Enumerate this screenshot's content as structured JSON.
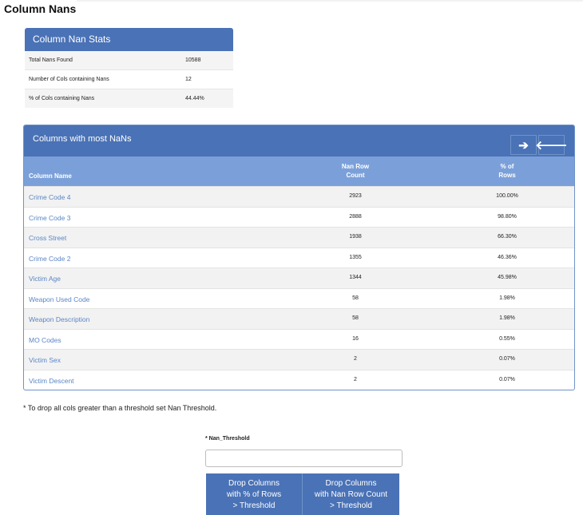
{
  "page": {
    "title": "Column Nans"
  },
  "stats": {
    "title": "Column Nan Stats",
    "rows": [
      {
        "label": "Total Nans Found",
        "value": "10588"
      },
      {
        "label": "Number of Cols containing Nans",
        "value": "12"
      },
      {
        "label": "% of Cols containing Nans",
        "value": "44.44%"
      }
    ]
  },
  "nan_table": {
    "title": "Columns with most NaNs",
    "nav": {
      "next_glyph": "➔",
      "prev_glyph": "🡐"
    },
    "headers": {
      "column_name": "Column Name",
      "count_line1": "Nan Row",
      "count_line2": "Count",
      "pct_line1": "% of",
      "pct_line2": "Rows"
    },
    "rows": [
      {
        "name": "Crime Code 4",
        "count": "2923",
        "pct": "100.00%"
      },
      {
        "name": "Crime Code 3",
        "count": "2888",
        "pct": "98.80%"
      },
      {
        "name": "Cross Street",
        "count": "1938",
        "pct": "66.30%"
      },
      {
        "name": "Crime Code 2",
        "count": "1355",
        "pct": "46.36%"
      },
      {
        "name": "Victim Age",
        "count": "1344",
        "pct": "45.98%"
      },
      {
        "name": "Weapon Used Code",
        "count": "58",
        "pct": "1.98%"
      },
      {
        "name": "Weapon Description",
        "count": "58",
        "pct": "1.98%"
      },
      {
        "name": "MO Codes",
        "count": "16",
        "pct": "0.55%"
      },
      {
        "name": "Victim Sex",
        "count": "2",
        "pct": "0.07%"
      },
      {
        "name": "Victim Descent",
        "count": "2",
        "pct": "0.07%"
      }
    ]
  },
  "note": "* To drop all cols greater than a threshold set Nan Threshold.",
  "threshold": {
    "label": "* Nan_Threshold",
    "value": "",
    "placeholder": ""
  },
  "buttons": {
    "drop_pct": [
      "Drop Columns",
      "with % of Rows",
      "> Threshold"
    ],
    "drop_count": [
      "Drop Columns",
      "with Nan Row Count",
      "> Threshold"
    ]
  }
}
